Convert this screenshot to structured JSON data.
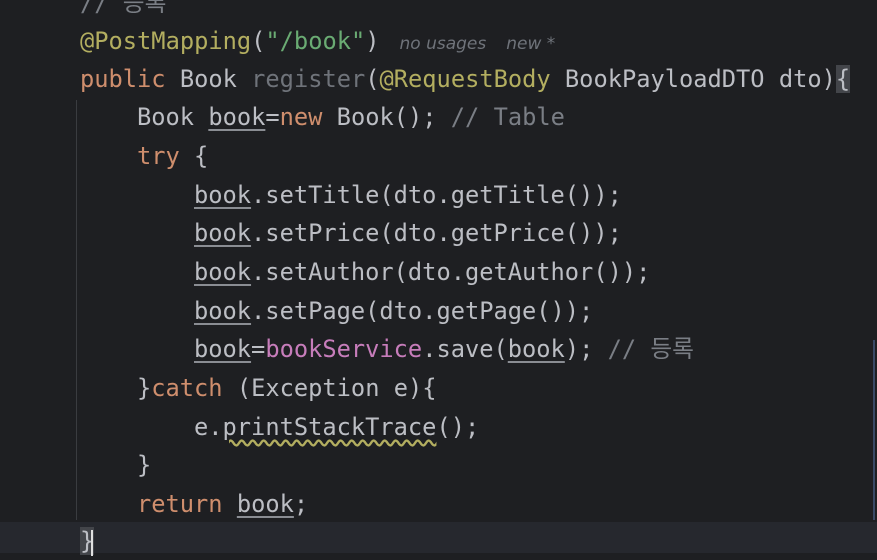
{
  "editor": {
    "lines": [
      {
        "indent": 0,
        "tokens": [
          {
            "t": "// 등록",
            "c": "cmt"
          }
        ]
      },
      {
        "indent": 0,
        "tokens": [
          {
            "t": "@PostMapping",
            "c": "ann"
          },
          {
            "t": "(",
            "c": ""
          },
          {
            "t": "\"/book\"",
            "c": "str"
          },
          {
            "t": ")",
            "c": ""
          }
        ],
        "hints": [
          "no usages",
          "new *"
        ]
      },
      {
        "indent": 0,
        "tokens": [
          {
            "t": "public",
            "c": "kw"
          },
          {
            "t": " Book ",
            "c": ""
          },
          {
            "t": "register",
            "c": "unused"
          },
          {
            "t": "(",
            "c": ""
          },
          {
            "t": "@RequestBody",
            "c": "ann"
          },
          {
            "t": " BookPayloadDTO dto)",
            "c": ""
          },
          {
            "t": "{",
            "c": "brace-match"
          }
        ]
      },
      {
        "indent": 1,
        "tokens": [
          {
            "t": "Book ",
            "c": ""
          },
          {
            "t": "book",
            "c": "ul"
          },
          {
            "t": "=",
            "c": ""
          },
          {
            "t": "new",
            "c": "kw"
          },
          {
            "t": " Book(); ",
            "c": ""
          },
          {
            "t": "// Table",
            "c": "cmt"
          }
        ]
      },
      {
        "indent": 1,
        "tokens": [
          {
            "t": "try",
            "c": "kw"
          },
          {
            "t": " {",
            "c": ""
          }
        ]
      },
      {
        "indent": 2,
        "tokens": [
          {
            "t": "book",
            "c": "ul"
          },
          {
            "t": ".setTitle(dto.getTitle());",
            "c": ""
          }
        ]
      },
      {
        "indent": 2,
        "tokens": [
          {
            "t": "book",
            "c": "ul"
          },
          {
            "t": ".setPrice(dto.getPrice());",
            "c": ""
          }
        ]
      },
      {
        "indent": 2,
        "tokens": [
          {
            "t": "book",
            "c": "ul"
          },
          {
            "t": ".setAuthor(dto.getAuthor());",
            "c": ""
          }
        ]
      },
      {
        "indent": 2,
        "tokens": [
          {
            "t": "book",
            "c": "ul"
          },
          {
            "t": ".setPage(dto.getPage());",
            "c": ""
          }
        ]
      },
      {
        "indent": 2,
        "tokens": [
          {
            "t": "book",
            "c": "ul"
          },
          {
            "t": "=",
            "c": ""
          },
          {
            "t": "bookService",
            "c": "fld"
          },
          {
            "t": ".save(",
            "c": ""
          },
          {
            "t": "book",
            "c": "ul"
          },
          {
            "t": "); ",
            "c": ""
          },
          {
            "t": "// 등록",
            "c": "cmt"
          }
        ]
      },
      {
        "indent": 1,
        "tokens": [
          {
            "t": "}",
            "c": ""
          },
          {
            "t": "catch",
            "c": "kw"
          },
          {
            "t": " (Exception e){",
            "c": ""
          }
        ]
      },
      {
        "indent": 2,
        "tokens": [
          {
            "t": "e.",
            "c": ""
          },
          {
            "t": "printStackTrace",
            "c": "warn"
          },
          {
            "t": "();",
            "c": ""
          }
        ]
      },
      {
        "indent": 1,
        "tokens": [
          {
            "t": "}",
            "c": ""
          }
        ]
      },
      {
        "indent": 1,
        "tokens": [
          {
            "t": "return",
            "c": "kw"
          },
          {
            "t": " ",
            "c": ""
          },
          {
            "t": "book",
            "c": "ul"
          },
          {
            "t": ";",
            "c": ""
          }
        ]
      },
      {
        "indent": 0,
        "tokens": [
          {
            "t": "}",
            "c": "brace-match"
          }
        ],
        "cursor": true
      }
    ]
  }
}
